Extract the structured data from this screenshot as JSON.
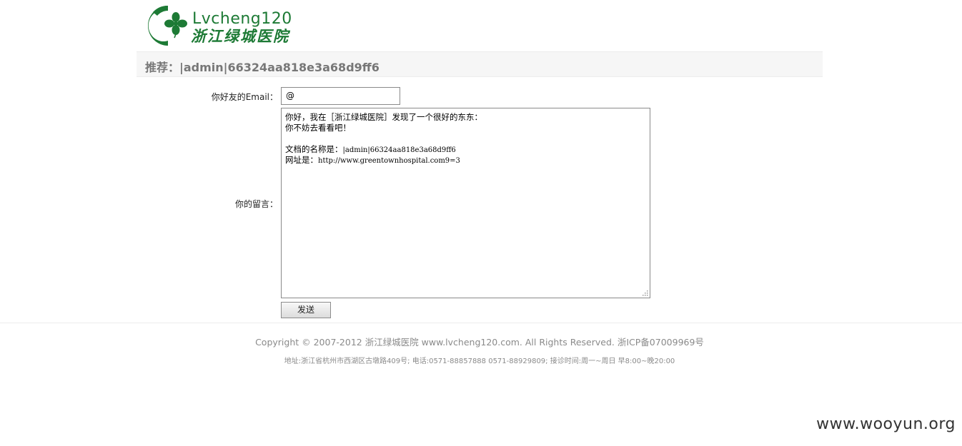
{
  "logo": {
    "english": "Lvcheng120",
    "chinese": "浙江绿城医院"
  },
  "page": {
    "title": "推荐：|admin|66324aa818e3a68d9ff6"
  },
  "form": {
    "email_label": "你好友的Email：",
    "email_value": "@",
    "message_label": "你的留言：",
    "message_lines": [
      "你好，我在［浙江绿城医院］发现了一个很好的东东：",
      "你不妨去看看吧！",
      "",
      "文档的名称是：",
      "|admin|66324aa818e3a68d9ff6",
      "网址是：",
      "http://www.greentownhospital.com9=3"
    ],
    "send_label": "发送"
  },
  "footer": {
    "copyright": "Copyright © 2007-2012 浙江绿城医院 www.lvcheng120.com. All Rights Reserved. 浙ICP备07009969号",
    "address": "地址:浙江省杭州市西湖区古墩路409号; 电话:0571-88857888 0571-88929809; 接诊时间:周一~周日 早8:00~晚20:00"
  },
  "watermark": "www.wooyun.org",
  "colors": {
    "brand_green": "#1d7a35",
    "title_gray": "#777777",
    "footer_gray": "#8a8a8a"
  }
}
